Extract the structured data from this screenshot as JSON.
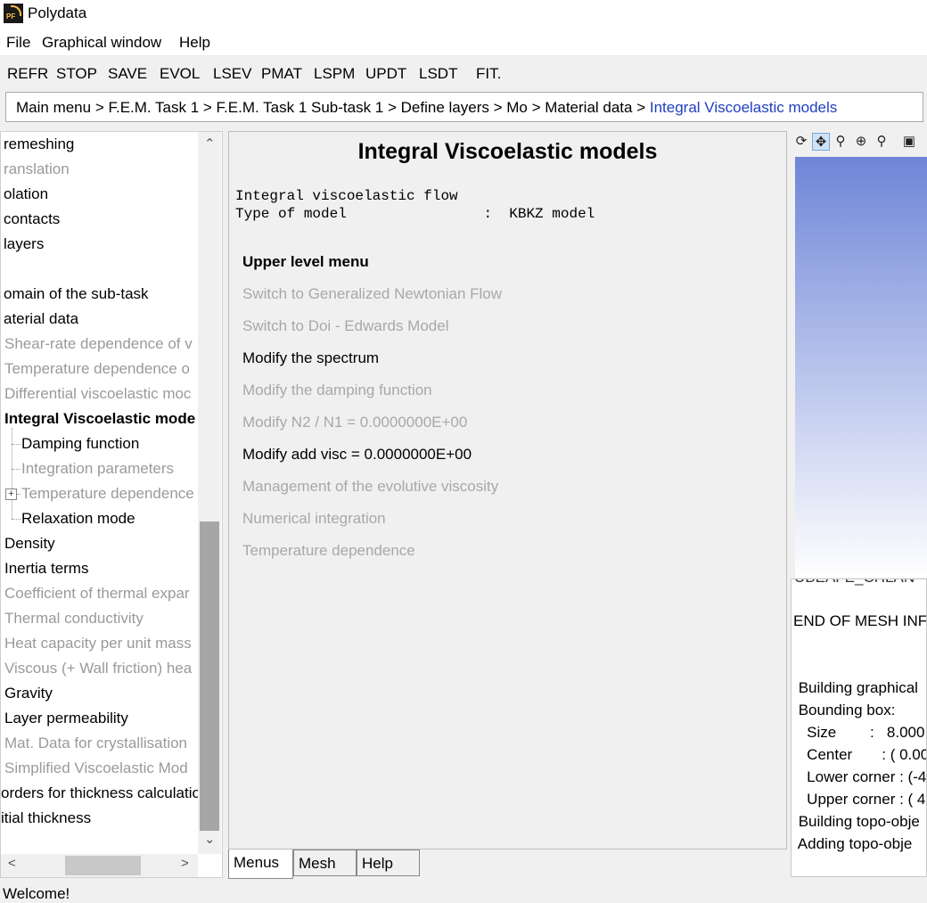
{
  "window": {
    "title": "Polydata",
    "icon_text": "PF"
  },
  "menubar": [
    "File",
    "Graphical window",
    "Help"
  ],
  "toolbar": [
    "REFR",
    "STOP",
    "SAVE",
    "EVOL",
    "LSEV",
    "PMAT",
    "LSPM",
    "UPDT",
    "LSDT",
    "FIT."
  ],
  "breadcrumb": {
    "path": "Main menu > F.E.M. Task  1 > F.E.M. Task  1  Sub-task  1 > Define layers > Mo > Material data > ",
    "current": "Integral Viscoelastic models"
  },
  "tree": [
    {
      "label": "remeshing"
    },
    {
      "label": "ranslation"
    },
    {
      "label": "olation"
    },
    {
      "label": "contacts"
    },
    {
      "label": "layers"
    },
    {
      "label": ""
    },
    {
      "label": "omain of the sub-task"
    },
    {
      "label": "aterial data"
    },
    {
      "label": "Shear-rate dependence of v"
    },
    {
      "label": "Temperature dependence o"
    },
    {
      "label": "Differential viscoelastic moc"
    },
    {
      "label": "Integral Viscoelastic mode"
    },
    {
      "label": "Damping function"
    },
    {
      "label": "Integration parameters"
    },
    {
      "label": "Temperature dependence"
    },
    {
      "label": "Relaxation mode"
    },
    {
      "label": "Density"
    },
    {
      "label": "Inertia terms"
    },
    {
      "label": "Coefficient of thermal expar"
    },
    {
      "label": "Thermal conductivity"
    },
    {
      "label": "Heat capacity per unit mass"
    },
    {
      "label": "Viscous (+ Wall friction) hea"
    },
    {
      "label": "Gravity"
    },
    {
      "label": "Layer permeability"
    },
    {
      "label": "Mat. Data for crystallisation"
    },
    {
      "label": "Simplified Viscoelastic Mod"
    },
    {
      "label": "orders for thickness calculatio"
    },
    {
      "label": "itial thickness"
    }
  ],
  "panel": {
    "title": "Integral Viscoelastic models",
    "info_line1": "Integral viscoelastic flow",
    "info_line2": "Type of model                :  KBKZ model",
    "items": [
      {
        "label": "Upper level menu"
      },
      {
        "label": "Switch to Generalized Newtonian Flow"
      },
      {
        "label": "Switch to Doi - Edwards Model"
      },
      {
        "label": "Modify the spectrum"
      },
      {
        "label": "Modify the damping function"
      },
      {
        "label": "Modify N2 / N1  =  0.0000000E+00"
      },
      {
        "label": "Modify add visc =  0.0000000E+00"
      },
      {
        "label": "Management of the evolutive viscosity"
      },
      {
        "label": "Numerical integration"
      },
      {
        "label": "Temperature dependence"
      }
    ]
  },
  "tabs": [
    "Menus",
    "Mesh",
    "Help"
  ],
  "console": [
    "UBEAFE_CHLAN",
    "",
    "END OF MESH INFO",
    "",
    "",
    " Building graphical",
    " Bounding box:",
    "   Size        :   8.000",
    "   Center       : ( 0.00",
    "   Lower corner : (-4",
    "   Upper corner : ( 4",
    " Building topo-obje",
    " Adding topo-obje"
  ],
  "status": "Welcome!"
}
